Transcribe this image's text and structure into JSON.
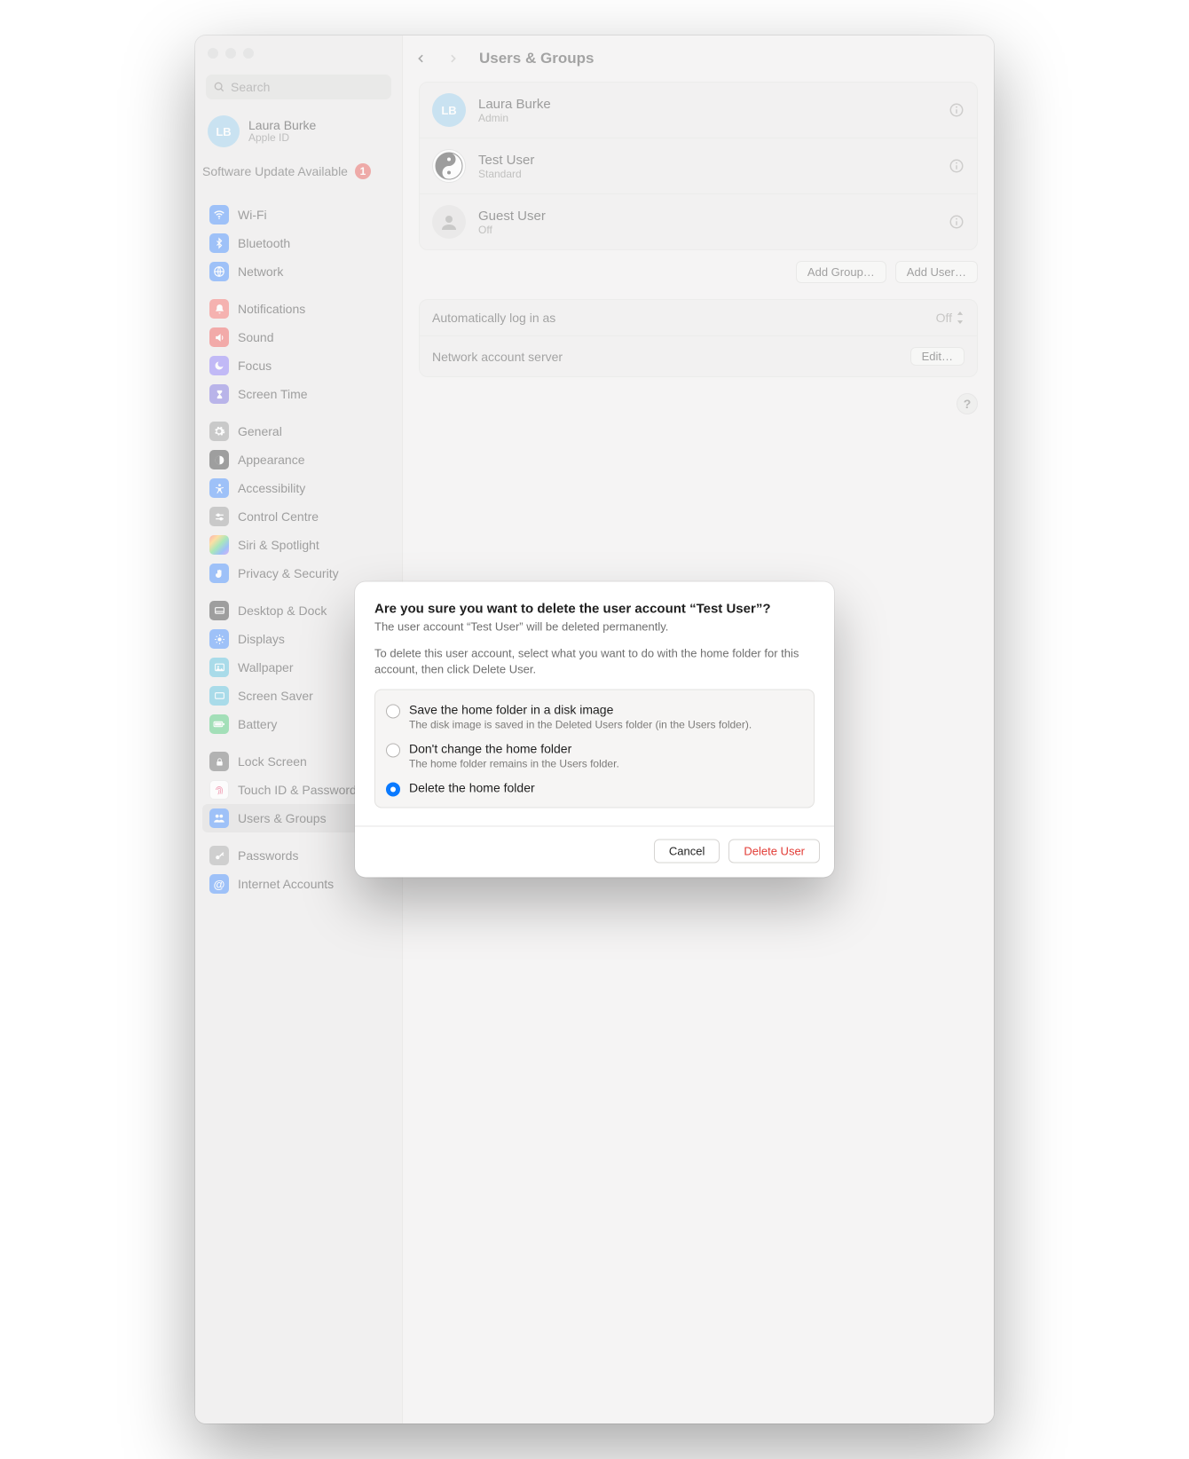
{
  "window_title": "Users & Groups",
  "search": {
    "placeholder": "Search"
  },
  "profile": {
    "initials": "LB",
    "name": "Laura Burke",
    "sub": "Apple ID"
  },
  "software_update": {
    "label": "Software Update Available",
    "count": "1"
  },
  "sidebar": {
    "items": [
      {
        "label": "Wi-Fi"
      },
      {
        "label": "Bluetooth"
      },
      {
        "label": "Network"
      },
      {
        "label": "Notifications"
      },
      {
        "label": "Sound"
      },
      {
        "label": "Focus"
      },
      {
        "label": "Screen Time"
      },
      {
        "label": "General"
      },
      {
        "label": "Appearance"
      },
      {
        "label": "Accessibility"
      },
      {
        "label": "Control Centre"
      },
      {
        "label": "Siri & Spotlight"
      },
      {
        "label": "Privacy & Security"
      },
      {
        "label": "Desktop & Dock"
      },
      {
        "label": "Displays"
      },
      {
        "label": "Wallpaper"
      },
      {
        "label": "Screen Saver"
      },
      {
        "label": "Battery"
      },
      {
        "label": "Lock Screen"
      },
      {
        "label": "Touch ID & Password"
      },
      {
        "label": "Users & Groups"
      },
      {
        "label": "Passwords"
      },
      {
        "label": "Internet Accounts"
      }
    ],
    "selected_index": 20
  },
  "users": [
    {
      "initials": "LB",
      "name": "Laura Burke",
      "role": "Admin"
    },
    {
      "initials": "",
      "name": "Test User",
      "role": "Standard"
    },
    {
      "initials": "",
      "name": "Guest User",
      "role": "Off"
    }
  ],
  "actions": {
    "add_group": "Add Group…",
    "add_user": "Add User…"
  },
  "settings": {
    "auto_login_label": "Automatically log in as",
    "auto_login_value": "Off",
    "network_label": "Network account server",
    "edit": "Edit…"
  },
  "modal": {
    "title": "Are you sure you want to delete the user account “Test User”?",
    "subtitle": "The user account “Test User” will be deleted permanently.",
    "description": "To delete this user account, select what you want to do with the home folder for this account, then click Delete User.",
    "options": [
      {
        "title": "Save the home folder in a disk image",
        "desc": "The disk image is saved in the Deleted Users folder (in the Users folder)."
      },
      {
        "title": "Don't change the home folder",
        "desc": "The home folder remains in the Users folder."
      },
      {
        "title": "Delete the home folder",
        "desc": ""
      }
    ],
    "selected_option": 2,
    "cancel": "Cancel",
    "confirm": "Delete User"
  }
}
